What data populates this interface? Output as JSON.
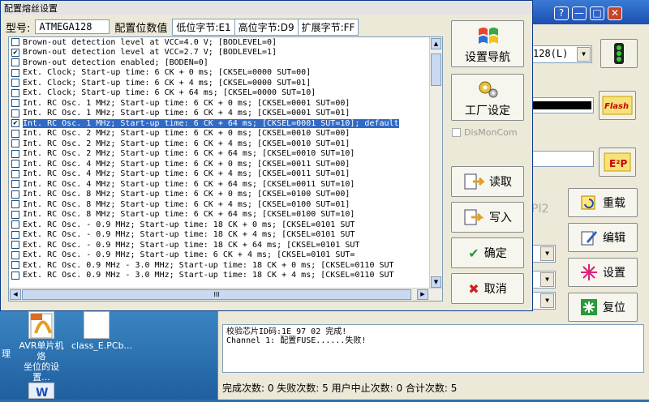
{
  "dialog": {
    "title": "配置熔丝设置",
    "model_label": "型号:",
    "model_value": "ATMEGA128",
    "config_label": "配置位数值",
    "low_byte": "低位字节:E1",
    "high_byte": "高位字节:D9",
    "ext_byte": "扩展字节:FF",
    "fuse_rows": [
      {
        "text": "Brown-out detection level at VCC=4.0 V; [BODLEVEL=0]",
        "checked": false,
        "selected": false
      },
      {
        "text": "Brown-out detection level at VCC=2.7 V; [BODLEVEL=1]",
        "checked": true,
        "selected": false
      },
      {
        "text": "Brown-out detection enabled; [BODEN=0]",
        "checked": false,
        "selected": false
      },
      {
        "text": "Ext. Clock; Start-up time: 6 CK + 0 ms; [CKSEL=0000 SUT=00]",
        "checked": false,
        "selected": false
      },
      {
        "text": "Ext. Clock; Start-up time: 6 CK + 4 ms; [CKSEL=0000 SUT=01]",
        "checked": false,
        "selected": false
      },
      {
        "text": "Ext. Clock; Start-up time: 6 CK + 64 ms; [CKSEL=0000 SUT=10]",
        "checked": false,
        "selected": false
      },
      {
        "text": "Int. RC Osc. 1 MHz; Start-up time: 6 CK + 0 ms; [CKSEL=0001 SUT=00]",
        "checked": false,
        "selected": false
      },
      {
        "text": "Int. RC Osc. 1 MHz; Start-up time: 6 CK + 4 ms; [CKSEL=0001 SUT=01]",
        "checked": false,
        "selected": false
      },
      {
        "text": "Int. RC Osc. 1 MHz; Start-up time: 6 CK + 64 ms; [CKSEL=0001 SUT=10]; default",
        "checked": true,
        "selected": true
      },
      {
        "text": "Int. RC Osc. 2 MHz; Start-up time: 6 CK + 0 ms; [CKSEL=0010 SUT=00]",
        "checked": false,
        "selected": false
      },
      {
        "text": "Int. RC Osc. 2 MHz; Start-up time: 6 CK + 4 ms; [CKSEL=0010 SUT=01]",
        "checked": false,
        "selected": false
      },
      {
        "text": "Int. RC Osc. 2 MHz; Start-up time: 6 CK + 64 ms; [CKSEL=0010 SUT=10]",
        "checked": false,
        "selected": false
      },
      {
        "text": "Int. RC Osc. 4 MHz; Start-up time: 6 CK + 0 ms; [CKSEL=0011 SUT=00]",
        "checked": false,
        "selected": false
      },
      {
        "text": "Int. RC Osc. 4 MHz; Start-up time: 6 CK + 4 ms; [CKSEL=0011 SUT=01]",
        "checked": false,
        "selected": false
      },
      {
        "text": "Int. RC Osc. 4 MHz; Start-up time: 6 CK + 64 ms; [CKSEL=0011 SUT=10]",
        "checked": false,
        "selected": false
      },
      {
        "text": "Int. RC Osc. 8 MHz; Start-up time: 6 CK + 0 ms; [CKSEL=0100 SUT=00]",
        "checked": false,
        "selected": false
      },
      {
        "text": "Int. RC Osc. 8 MHz; Start-up time: 6 CK + 4 ms; [CKSEL=0100 SUT=01]",
        "checked": false,
        "selected": false
      },
      {
        "text": "Int. RC Osc. 8 MHz; Start-up time: 6 CK + 64 ms; [CKSEL=0100 SUT=10]",
        "checked": false,
        "selected": false
      },
      {
        "text": "Ext. RC Osc.         - 0.9 MHz; Start-up time: 18 CK + 0 ms; [CKSEL=0101 SUT",
        "checked": false,
        "selected": false
      },
      {
        "text": "Ext. RC Osc.         - 0.9 MHz; Start-up time: 18 CK + 4 ms; [CKSEL=0101 SUT",
        "checked": false,
        "selected": false
      },
      {
        "text": "Ext. RC Osc.         - 0.9 MHz; Start-up time: 18 CK + 64 ms; [CKSEL=0101 SUT",
        "checked": false,
        "selected": false
      },
      {
        "text": "Ext. RC Osc.         - 0.9 MHz; Start-up time: 6 CK + 4 ms; [CKSEL=0101 SUT=",
        "checked": false,
        "selected": false
      },
      {
        "text": "Ext. RC Osc. 0.9 MHz - 3.0 MHz; Start-up time: 18 CK + 0 ms; [CKSEL=0110 SUT",
        "checked": false,
        "selected": false
      },
      {
        "text": "Ext. RC Osc. 0.9 MHz - 3.0 MHz; Start-up time: 18 CK + 4 ms; [CKSEL=0110 SUT",
        "checked": false,
        "selected": false
      }
    ],
    "hscroll_grip": "III",
    "buttons": {
      "wizard": "设置导航",
      "factory": "工厂设定",
      "dismoncom": "DisMonCom",
      "read": "读取",
      "write": "写入",
      "ok": "确定",
      "cancel": "取消"
    }
  },
  "main": {
    "device_combo": "128(L)",
    "flash_label": "Flash",
    "eeprom_label": "E²P",
    "spi_label": "PI2",
    "side_buttons": {
      "reload": "重载",
      "edit": "编辑",
      "settings": "设置",
      "reset": "复位"
    },
    "log_lines": [
      "校验芯片ID码:1E 97 02 完成!",
      "Channel 1: 配置FUSE......失败!"
    ],
    "stats": "完成次数: 0  失败次数: 5  用户中止次数: 0  合计次数: 5",
    "window_buttons": {
      "help": "?",
      "min": "—",
      "max": "□",
      "close": "✕"
    }
  },
  "desktop": {
    "icons": [
      {
        "label": "AVR单片机烙\n坐位的设置..."
      },
      {
        "label": "class_E.PCb..."
      }
    ],
    "left_text": "理"
  }
}
